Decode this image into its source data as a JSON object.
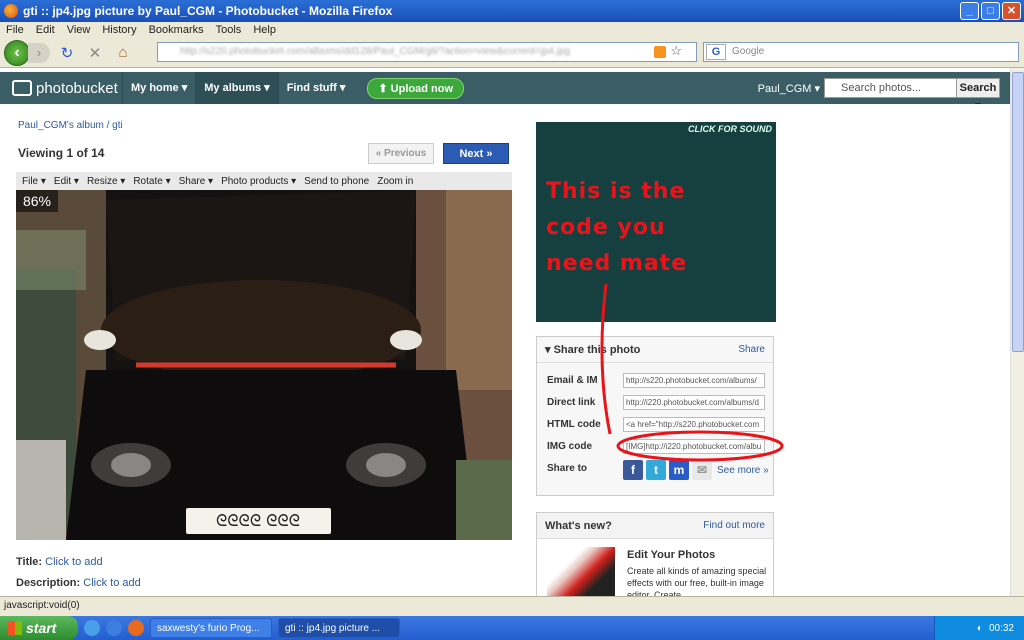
{
  "window": {
    "title": "gti :: jp4.jpg picture by Paul_CGM - Photobucket - Mozilla Firefox"
  },
  "menu": [
    "File",
    "Edit",
    "View",
    "History",
    "Bookmarks",
    "Tools",
    "Help"
  ],
  "nav": {
    "url": "http://s220.photobucket.com/albums/dd128/Paul_CGM/gti/?action=view&current=jp4.jpg",
    "search_placeholder": "Google"
  },
  "pb": {
    "logo": "photobucket",
    "nav": [
      "My home",
      "My albums",
      "Find stuff"
    ],
    "upload": "Upload now",
    "user": "Paul_CGM",
    "search_placeholder": "Search photos...",
    "search_button": "Search"
  },
  "album": {
    "breadcrumb": "Paul_CGM's album / gti",
    "viewing": "Viewing 1 of 14",
    "prev": "« Previous",
    "next": "Next »",
    "toolbar": [
      "File ▾",
      "Edit ▾",
      "Resize ▾",
      "Rotate ▾",
      "Share ▾",
      "Photo products ▾",
      "Send to phone",
      "Zoom in"
    ],
    "zoom": "86%",
    "title_label": "Title:",
    "title_link": "Click to add",
    "description_label": "Description:",
    "description_link": "Click to add"
  },
  "ad": {
    "sound": "CLICK FOR SOUND",
    "scrawl": [
      "This is the",
      "code you",
      "need mate"
    ]
  },
  "share": {
    "heading": "Share this photo",
    "link": "Share",
    "rows": [
      {
        "label": "Email & IM",
        "value": "http://s220.photobucket.com/albums/"
      },
      {
        "label": "Direct link",
        "value": "http://i220.photobucket.com/albums/d"
      },
      {
        "label": "HTML code",
        "value": "<a href=\"http://s220.photobucket.com"
      },
      {
        "label": "IMG code",
        "value": "[IMG]http://i220.photobucket.com/albu"
      }
    ],
    "share_to": "Share to",
    "see_more": "See more »"
  },
  "news": {
    "heading": "What's new?",
    "link": "Find out more",
    "title": "Edit Your Photos",
    "body": "Create all kinds of amazing special effects with our free, built-in image editor. Create"
  },
  "status": "javascript:void(0)",
  "taskbar": {
    "start": "start",
    "tasks": [
      "saxwesty's furio Prog...",
      "gti :: jp4.jpg picture ..."
    ],
    "clock": "00:32"
  }
}
